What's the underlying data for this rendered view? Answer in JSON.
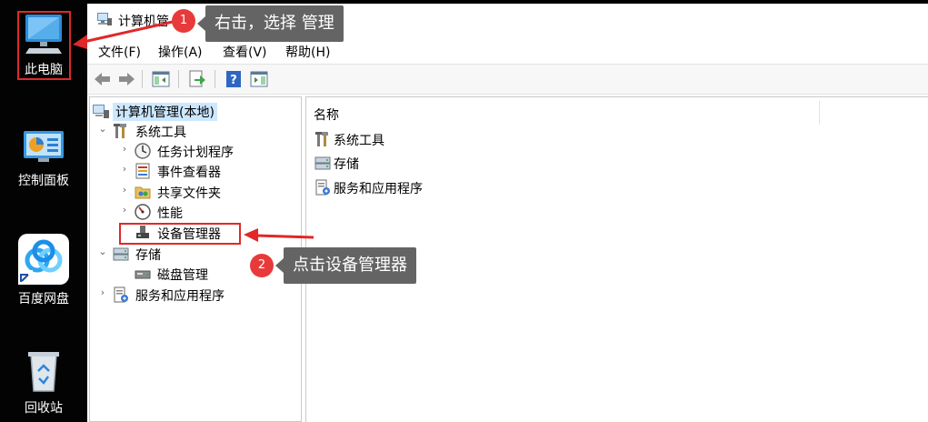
{
  "desktop": {
    "icons": [
      {
        "label": "此电脑",
        "icon": "computer-icon"
      },
      {
        "label": "控制面板",
        "icon": "control-panel-icon"
      },
      {
        "label": "百度网盘",
        "icon": "baidu-netdisk-icon"
      },
      {
        "label": "回收站",
        "icon": "recycle-bin-icon"
      }
    ]
  },
  "window": {
    "title": "计算机管",
    "menu": [
      "文件(F)",
      "操作(A)",
      "查看(V)",
      "帮助(H)"
    ],
    "toolbar": [
      "back-arrow-icon",
      "forward-arrow-icon",
      "show-hide-console-tree-icon",
      "export-list-icon",
      "help-icon",
      "action-pane-icon"
    ]
  },
  "tree": {
    "root": "计算机管理(本地)",
    "system_tools": "系统工具",
    "task_scheduler": "任务计划程序",
    "event_viewer": "事件查看器",
    "shared_folders": "共享文件夹",
    "performance": "性能",
    "device_manager": "设备管理器",
    "storage": "存储",
    "disk_management": "磁盘管理",
    "services_apps": "服务和应用程序",
    "expanded_glyph": "⌄",
    "collapsed_glyph": "›"
  },
  "list": {
    "column_name": "名称",
    "items": [
      "系统工具",
      "存储",
      "服务和应用程序"
    ]
  },
  "annotations": {
    "step1_number": "1",
    "step1_text": "右击，选择 管理",
    "step2_number": "2",
    "step2_text": "点击设备管理器",
    "accent_color": "#e02828",
    "callout_bg": "#646464"
  }
}
